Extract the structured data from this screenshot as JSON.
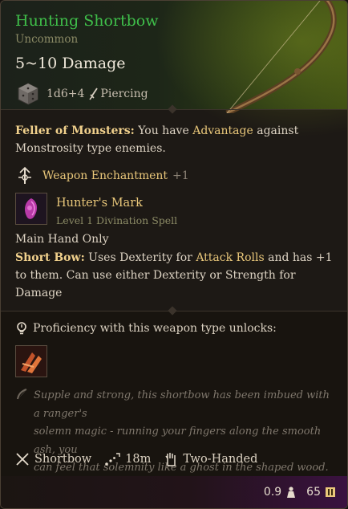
{
  "item": {
    "name": "Hunting Shortbow",
    "rarity": "Uncommon",
    "damage": "5~10 Damage",
    "damage_dice": "1d6+4",
    "damage_type": "Piercing"
  },
  "feller": {
    "name": "Feller of Monsters:",
    "text_a": " You have ",
    "advantage": "Advantage",
    "text_b": " against",
    "text_c": "Monstrosity type enemies."
  },
  "enchantment": {
    "label": "Weapon Enchantment",
    "value": "+1"
  },
  "spell": {
    "name": "Hunter's Mark",
    "subtitle": "Level 1 Divination Spell"
  },
  "main_hand": "Main Hand Only",
  "short_bow": {
    "name": "Short Bow:",
    "text_a": " Uses Dexterity for ",
    "attack_rolls": "Attack Rolls",
    "text_b": " and has +1",
    "line2": "to them. Can use either Dexterity or Strength for",
    "line3": "Damage"
  },
  "proficiency": {
    "label": "Proficiency with this weapon type unlocks:"
  },
  "flavor": [
    "Supple and strong, this shortbow has been imbued with a ranger's",
    "solemn magic - running your fingers along the smooth ash, you",
    "can feel that solemnity like a ghost in the shaped wood."
  ],
  "properties": {
    "type": "Shortbow",
    "range": "18m",
    "handed": "Two-Handed"
  },
  "footer": {
    "weight": "0.9",
    "value": "65"
  },
  "colors": {
    "title": "#3fbf4a",
    "gold": "#e9c77a",
    "rarity": "#8c8b66"
  }
}
